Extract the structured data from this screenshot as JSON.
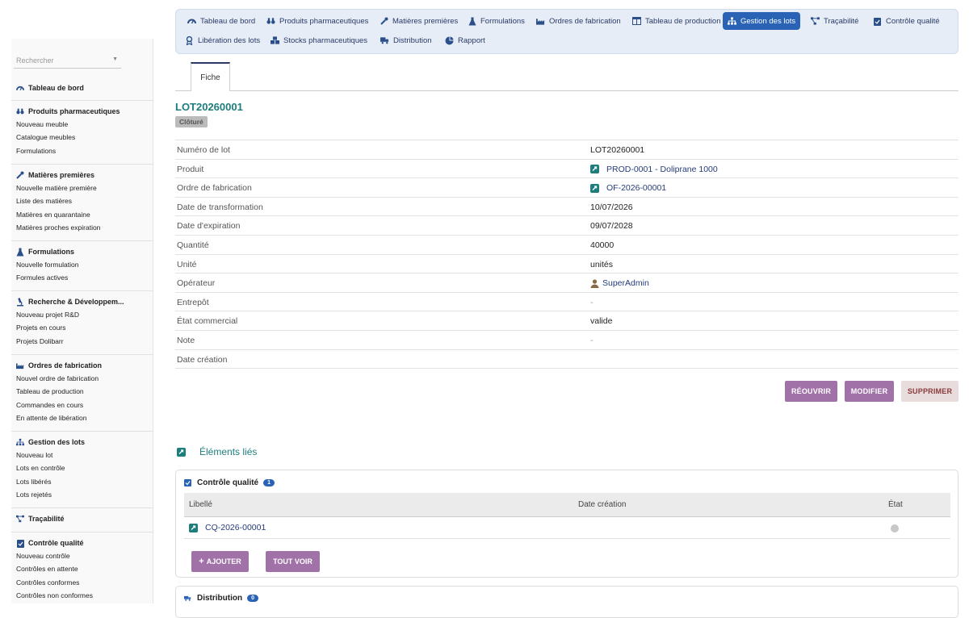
{
  "sidebar": {
    "search_placeholder": "Rechercher",
    "sections": [
      {
        "title": "Tableau de bord",
        "icon": "dashboard-icon",
        "items": []
      },
      {
        "title": "Produits pharmaceutiques",
        "icon": "binoculars-icon",
        "items": [
          "Nouveau meuble",
          "Catalogue meubles",
          "Formulations"
        ]
      },
      {
        "title": "Matières premières",
        "icon": "eyedropper-icon",
        "items": [
          "Nouvelle matière première",
          "Liste des matières",
          "Matières en quarantaine",
          "Matières proches expiration"
        ]
      },
      {
        "title": "Formulations",
        "icon": "flask-icon",
        "items": [
          "Nouvelle formulation",
          "Formules actives"
        ]
      },
      {
        "title": "Recherche & Développem...",
        "icon": "microscope-icon",
        "items": [
          "Nouveau projet R&D",
          "Projets en cours",
          "Projets Dolibarr"
        ]
      },
      {
        "title": "Ordres de fabrication",
        "icon": "industry-icon",
        "items": [
          "Nouvel ordre de fabrication",
          "Tableau de production",
          "Commandes en cours",
          "En attente de libération"
        ]
      },
      {
        "title": "Gestion des lots",
        "icon": "sitemap-icon",
        "items": [
          "Nouveau lot",
          "Lots en contrôle",
          "Lots libérés",
          "Lots rejetés"
        ]
      },
      {
        "title": "Traçabilité",
        "icon": "project-diagram-icon",
        "items": []
      },
      {
        "title": "Contrôle qualité",
        "icon": "clipboard-check-icon",
        "items": [
          "Nouveau contrôle",
          "Contrôles en attente",
          "Contrôles conformes",
          "Contrôles non conformes"
        ]
      }
    ]
  },
  "topnav": {
    "items": [
      {
        "label": "Tableau de bord",
        "icon": "dashboard-icon",
        "active": false
      },
      {
        "label": "Produits pharmaceutiques",
        "icon": "binoculars-icon",
        "active": false
      },
      {
        "label": "Matières premières",
        "icon": "eyedropper-icon",
        "active": false
      },
      {
        "label": "Formulations",
        "icon": "flask-icon",
        "active": false
      },
      {
        "label": "Ordres de fabrication",
        "icon": "industry-icon",
        "active": false
      },
      {
        "label": "Tableau de production",
        "icon": "table-icon",
        "active": false
      },
      {
        "label": "Gestion des lots",
        "icon": "sitemap-icon",
        "active": true
      },
      {
        "label": "Traçabilité",
        "icon": "project-diagram-icon",
        "active": false
      },
      {
        "label": "Contrôle qualité",
        "icon": "clipboard-check-icon",
        "active": false
      },
      {
        "label": "Libération des lots",
        "icon": "award-icon",
        "active": false
      },
      {
        "label": "Stocks pharmaceutiques",
        "icon": "boxes-icon",
        "active": false
      },
      {
        "label": "Distribution",
        "icon": "truck-icon",
        "active": false
      },
      {
        "label": "Rapport",
        "icon": "chart-pie-icon",
        "active": false
      }
    ]
  },
  "tabs": {
    "fiche": "Fiche"
  },
  "record": {
    "ref": "LOT20260001",
    "status": "Clôturé",
    "fields": [
      {
        "label": "Numéro de lot",
        "value": "LOT20260001",
        "type": "text"
      },
      {
        "label": "Produit",
        "value": "PROD-0001 - Doliprane 1000",
        "type": "link"
      },
      {
        "label": "Ordre de fabrication",
        "value": "OF-2026-00001",
        "type": "link"
      },
      {
        "label": "Date de transformation",
        "value": "10/07/2026",
        "type": "text"
      },
      {
        "label": "Date d'expiration",
        "value": "09/07/2028",
        "type": "text"
      },
      {
        "label": "Quantité",
        "value": "40000",
        "type": "text"
      },
      {
        "label": "Unité",
        "value": "unités",
        "type": "text"
      },
      {
        "label": "Opérateur",
        "value": "SuperAdmin",
        "type": "user"
      },
      {
        "label": "Entrepôt",
        "value": "-",
        "type": "dash"
      },
      {
        "label": "État commercial",
        "value": "valide",
        "type": "text"
      },
      {
        "label": "Note",
        "value": "-",
        "type": "dash"
      },
      {
        "label": "Date création",
        "value": "",
        "type": "text"
      }
    ]
  },
  "actions": {
    "reopen": "RÉOUVRIR",
    "modify": "MODIFIER",
    "delete": "SUPPRIMER"
  },
  "linked": {
    "title": "Éléments liés",
    "qc": {
      "title": "Contrôle qualité",
      "count": "1",
      "columns": [
        "Libellé",
        "Date création",
        "État"
      ],
      "rows": [
        {
          "label": "CQ-2026-00001",
          "date": "",
          "state": ""
        }
      ],
      "add_label": "AJOUTER",
      "see_all_label": "TOUT VOIR"
    },
    "distribution": {
      "title": "Distribution",
      "count": "0"
    }
  },
  "colors": {
    "accent": "#2a63b6",
    "button": "#a172a8",
    "title": "#1e7e7e",
    "link": "#263c7a"
  }
}
